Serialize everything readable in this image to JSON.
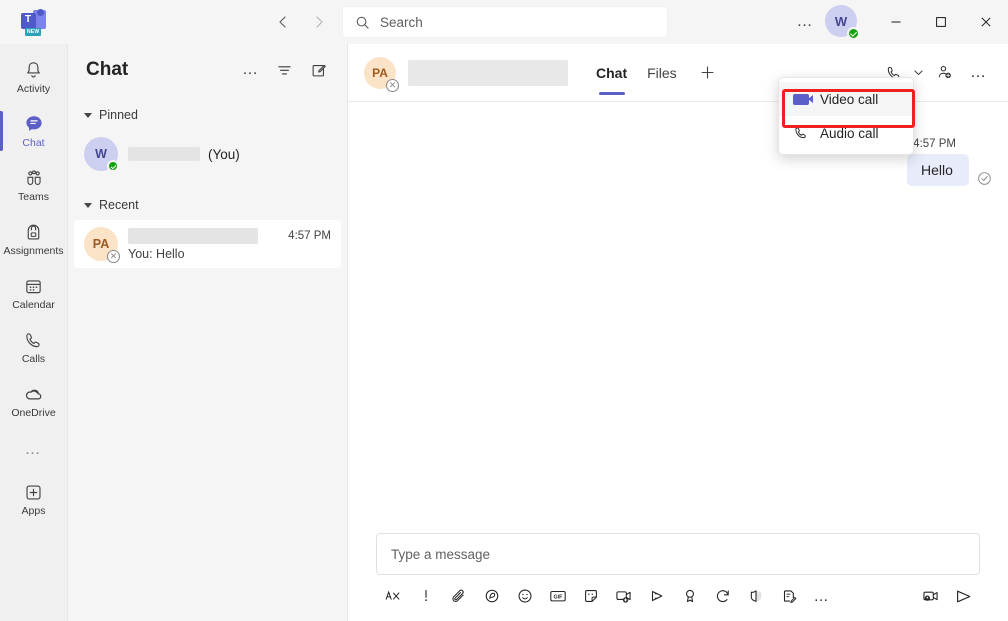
{
  "titlebar": {
    "logo_badge": "NEW",
    "nav": {
      "back": "back-arrow",
      "forward": "forward-arrow"
    },
    "search": {
      "placeholder": "Search",
      "value": ""
    },
    "settings_more": "…",
    "avatar": {
      "initials": "W",
      "status": "available"
    },
    "window": {
      "minimize": "minimize",
      "maximize": "maximize",
      "close": "close"
    }
  },
  "rail": {
    "items": [
      {
        "label": "Activity",
        "icon": "bell-icon",
        "active": false
      },
      {
        "label": "Chat",
        "icon": "chat-bubble-icon",
        "active": true
      },
      {
        "label": "Teams",
        "icon": "teams-people-icon",
        "active": false
      },
      {
        "label": "Assignments",
        "icon": "backpack-icon",
        "active": false
      },
      {
        "label": "Calendar",
        "icon": "calendar-icon",
        "active": false
      },
      {
        "label": "Calls",
        "icon": "phone-icon",
        "active": false
      },
      {
        "label": "OneDrive",
        "icon": "onedrive-cloud-icon",
        "active": false
      }
    ],
    "more": "…",
    "apps": {
      "label": "Apps",
      "icon": "plus-square-icon"
    }
  },
  "chatlist": {
    "title": "Chat",
    "header_buttons": {
      "more": "…",
      "filter": "filter-icon",
      "compose": "new-chat-icon"
    },
    "groups": [
      {
        "label": "Pinned",
        "rows": [
          {
            "initials": "W",
            "name_redacted": true,
            "suffix": "(You)",
            "time": "",
            "preview": "",
            "presence": "available",
            "selected": false
          }
        ]
      },
      {
        "label": "Recent",
        "rows": [
          {
            "initials": "PA",
            "name_redacted": true,
            "suffix": "",
            "time": "4:57 PM",
            "preview": "You: Hello",
            "presence": "offline",
            "selected": true
          }
        ]
      }
    ]
  },
  "chat_header": {
    "avatar_initials": "PA",
    "name_redacted": true,
    "tabs": [
      {
        "label": "Chat",
        "active": true
      },
      {
        "label": "Files",
        "active": false
      }
    ],
    "add_tab": "+",
    "actions": {
      "call": "phone-icon",
      "call_chevron": "chevron-down-icon",
      "add_people": "add-person-icon",
      "more": "…"
    }
  },
  "call_menu": {
    "items": [
      {
        "label": "Video call",
        "icon": "video-camera-icon",
        "highlighted": true
      },
      {
        "label": "Audio call",
        "icon": "phone-icon",
        "highlighted": false
      }
    ]
  },
  "messages": [
    {
      "time": "4:57 PM",
      "text": "Hello",
      "outgoing": true,
      "status": "delivered"
    }
  ],
  "compose": {
    "placeholder": "Type a message",
    "value": "",
    "tools": [
      "format-icon",
      "important-icon",
      "attach-icon",
      "loop-icon",
      "emoji-icon",
      "gif-icon",
      "sticker-icon",
      "meet-now-icon",
      "send-later-icon",
      "praise-icon",
      "loop-refresh-icon",
      "approvals-icon",
      "forms-icon",
      "more-icon"
    ],
    "right_tools": [
      "video-clip-icon",
      "send-icon"
    ]
  },
  "colors": {
    "accent": "#5b5fc7",
    "highlight_box": "#f02020",
    "bubble": "#e8ebfa",
    "presence_available": "#13a10e"
  }
}
